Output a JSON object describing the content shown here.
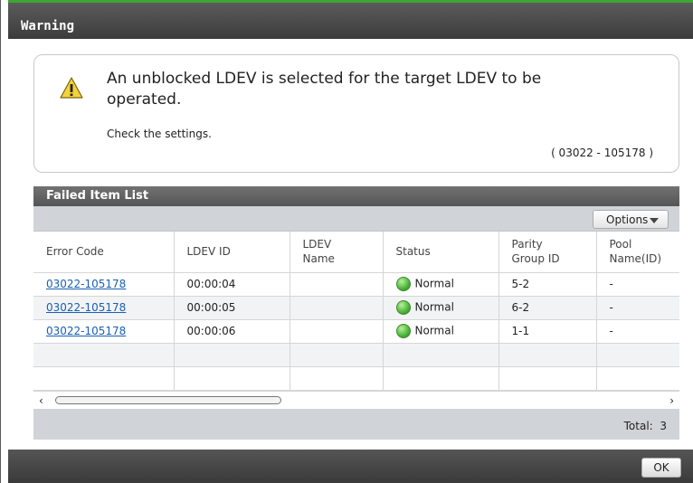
{
  "window": {
    "title": "Warning"
  },
  "message": {
    "main": "An unblocked LDEV is selected for the target LDEV to be operated.",
    "sub": "Check the settings.",
    "code": "( 03022 - 105178 )",
    "icon": "warning-icon"
  },
  "failed_list": {
    "title": "Failed Item List",
    "options_label": "Options",
    "columns": [
      "Error Code",
      "LDEV ID",
      "LDEV Name",
      "Status",
      "Parity Group ID",
      "Pool Name(ID)"
    ],
    "rows": [
      {
        "error_code": "03022-105178",
        "ldev_id": "00:00:04",
        "ldev_name": "",
        "status": "Normal",
        "parity_group": "5-2",
        "pool": "-"
      },
      {
        "error_code": "03022-105178",
        "ldev_id": "00:00:05",
        "ldev_name": "",
        "status": "Normal",
        "parity_group": "6-2",
        "pool": "-"
      },
      {
        "error_code": "03022-105178",
        "ldev_id": "00:00:06",
        "ldev_name": "",
        "status": "Normal",
        "parity_group": "1-1",
        "pool": "-"
      }
    ],
    "total_label": "Total:",
    "total_value": "3"
  },
  "buttons": {
    "ok": "OK"
  },
  "colors": {
    "accent": "#3fa535",
    "link": "#1a5fb4",
    "status_normal": "#4bb43a"
  }
}
